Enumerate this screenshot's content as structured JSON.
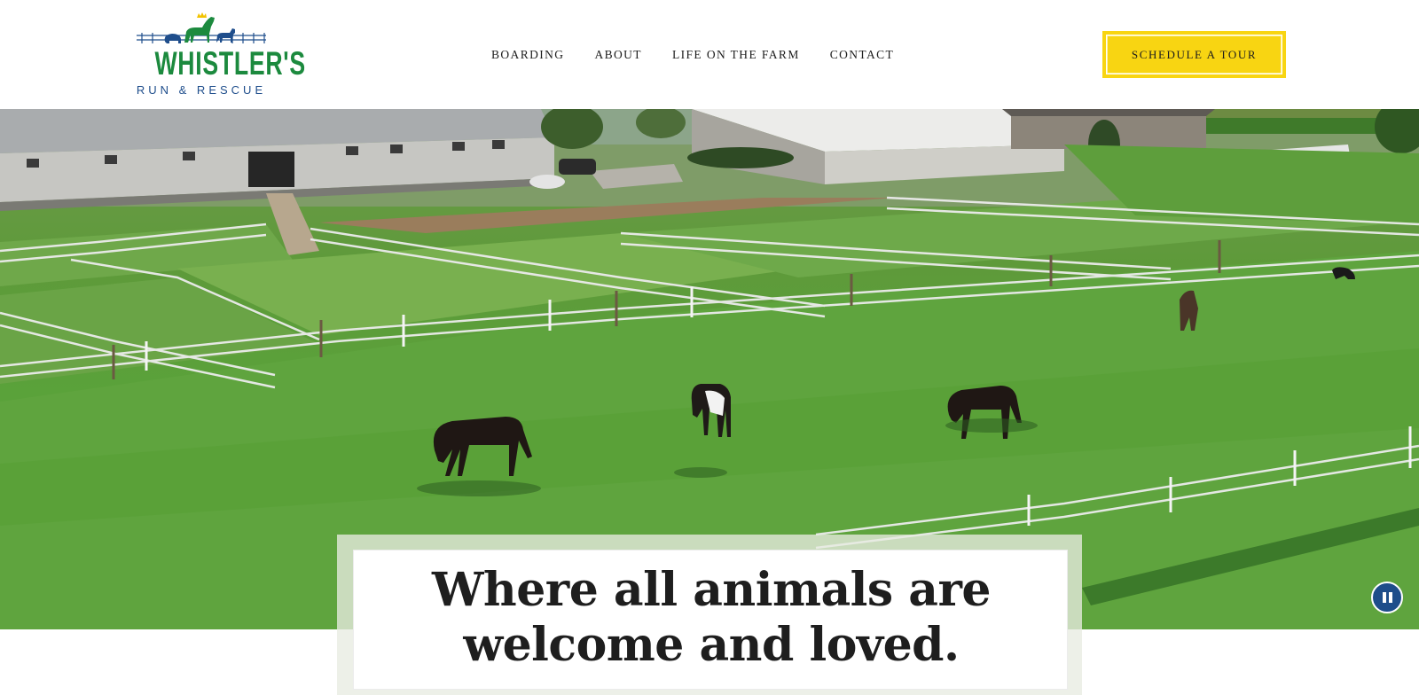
{
  "logo": {
    "name": "WHISTLER'S",
    "tagline": "RUN & RESCUE",
    "icon": "farm-animals-logo"
  },
  "nav": {
    "items": [
      {
        "label": "BOARDING"
      },
      {
        "label": "ABOUT"
      },
      {
        "label": "LIFE ON THE FARM"
      },
      {
        "label": "CONTACT"
      }
    ]
  },
  "cta": {
    "label": "SCHEDULE A TOUR"
  },
  "hero": {
    "media": "video-background-farm-horses",
    "headline_line1": "Where all animals are",
    "headline_line2": "welcome and loved.",
    "pause_icon": "pause-icon"
  },
  "colors": {
    "brand_green": "#1c8a3e",
    "brand_blue": "#1f4e8c",
    "cta_yellow": "#f8d512",
    "pause_blue": "#1e4d8a"
  }
}
